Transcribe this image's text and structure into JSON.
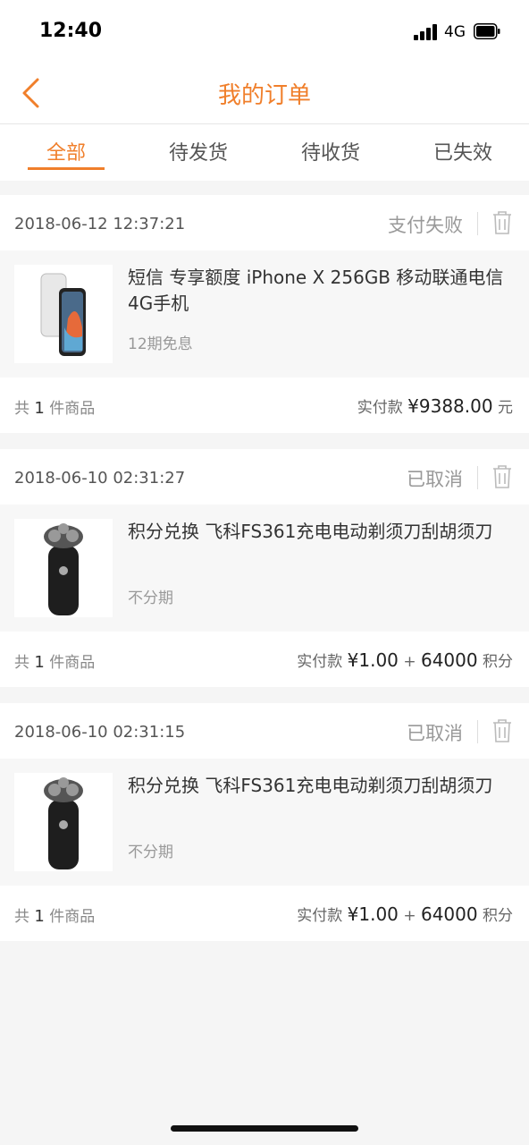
{
  "status_bar": {
    "time": "12:40",
    "network": "4G"
  },
  "header": {
    "title": "我的订单"
  },
  "tabs": [
    {
      "label": "全部",
      "active": true
    },
    {
      "label": "待发货",
      "active": false
    },
    {
      "label": "待收货",
      "active": false
    },
    {
      "label": "已失效",
      "active": false
    }
  ],
  "orders": [
    {
      "datetime": "2018-06-12 12:37:21",
      "status": "支付失败",
      "product_name": "短信 专享额度 iPhone X 256GB 移动联通电信4G手机",
      "installment": "12期免息",
      "item_count_prefix": "共",
      "item_count": "1",
      "item_count_suffix": "件商品",
      "paid_label": "实付款",
      "paid_amount": "¥9388.00",
      "paid_unit": "元"
    },
    {
      "datetime": "2018-06-10 02:31:27",
      "status": "已取消",
      "product_name": "积分兑换 飞科FS361充电电动剃须刀刮胡须刀",
      "installment": "不分期",
      "item_count_prefix": "共",
      "item_count": "1",
      "item_count_suffix": "件商品",
      "paid_label": "实付款",
      "paid_amount": "¥1.00",
      "paid_plus": "+",
      "paid_points": "64000",
      "paid_unit": "积分"
    },
    {
      "datetime": "2018-06-10 02:31:15",
      "status": "已取消",
      "product_name": "积分兑换 飞科FS361充电电动剃须刀刮胡须刀",
      "installment": "不分期",
      "item_count_prefix": "共",
      "item_count": "1",
      "item_count_suffix": "件商品",
      "paid_label": "实付款",
      "paid_amount": "¥1.00",
      "paid_plus": "+",
      "paid_points": "64000",
      "paid_unit": "积分"
    }
  ],
  "colors": {
    "accent": "#f07f2b",
    "background": "#f5f5f5"
  }
}
